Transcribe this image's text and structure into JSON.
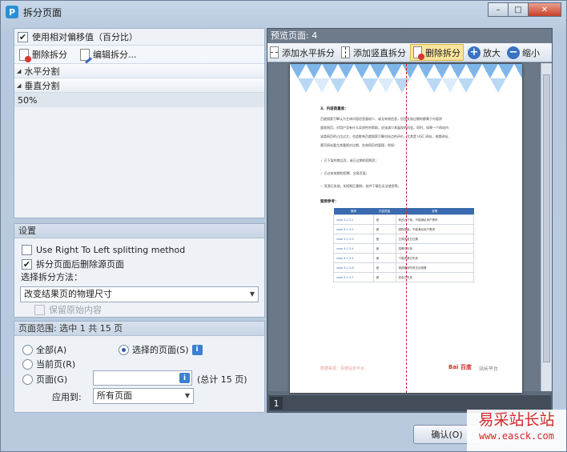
{
  "window": {
    "title": "拆分页面",
    "app_icon_letter": "P",
    "controls": [
      "minimize",
      "maximize",
      "close"
    ]
  },
  "split_panel": {
    "use_relative_offset_label": "使用相对偏移值（百分比）",
    "use_relative_offset_checked": true,
    "toolbar": {
      "delete_label": "删除拆分",
      "edit_label": "编辑拆分..."
    },
    "horizontal_group": "水平分割",
    "vertical_group": "垂直分割",
    "items": [
      {
        "value": "50%"
      }
    ]
  },
  "settings": {
    "title": "设置",
    "rtl_label": "Use Right To Left splitting method",
    "rtl_checked": false,
    "delete_source_label": "拆分页面后删除源页面",
    "delete_source_checked": true,
    "method_label": "选择拆分方法：",
    "method_value": "改变结果页的物理尺寸",
    "keep_content_label": "保留原始内容",
    "keep_content_checked": false
  },
  "page_range": {
    "title": "页面范围: 选中 1 共 15 页",
    "all_label": "全部(A)",
    "current_label": "当前页(R)",
    "pages_label": "页面(G)",
    "selected_label": "选择的页面(S)",
    "selected_on": true,
    "pages_value": "",
    "total_label": "(总计 15 页)",
    "apply_to_label": "应用到:",
    "apply_to_value": "所有页面"
  },
  "preview": {
    "label": "预览页面: 4",
    "toolbar": {
      "add_horizontal": "添加水平拆分",
      "add_vertical": "添加竖直拆分",
      "delete": "删除拆分",
      "zoom_in": "放大",
      "zoom_out": "缩小"
    },
    "page_tab": "1",
    "document": {
      "heading": "3、内容质量差：",
      "paragraph_lines": [
        "百度搜索引擎认为主体内容信息量较少，或无有效信息，信息失效过期的都属于内容质",
        "量差网页，对用户没有什么实质性的帮助，应该减少其展现的机会。同时，如果一个网站内",
        "该类网页的占比过大，也会影响百度搜索引擎对站点的评价，尤其是 UGC 网站、电商网站、",
        "黄页网站要尤其重视对过期、失效网页的管理，例如："
      ],
      "bullets": [
        "已下架的商品页，或已过期的团购页；",
        "已过有效期的招聘、交易页面；",
        "资源已失效，如视频已删除、软件下载后无法使用等。"
      ],
      "case_title": "案例参考：",
      "table_headers": [
        "案例",
        "内容质量",
        "说明"
      ],
      "table_rows": [
        [
          "case 3.1.3-1",
          "差",
          "商品已下架，不能满足用户需求"
        ],
        [
          "case 3.1.3-2",
          "差",
          "团购结束，不能满足用户需求"
        ],
        [
          "case 3.1.3-3",
          "差",
          "交易信息已过期"
        ],
        [
          "case 3.1.3-4",
          "差",
          "招聘已失效"
        ],
        [
          "case 3.1.3-5",
          "差",
          "下载资源已失效"
        ],
        [
          "case 3.1.3-6",
          "差",
          "视频播放失败无法观看"
        ],
        [
          "case 3.1.3-7",
          "差",
          "信息已失效"
        ]
      ],
      "footer_source": "数据来源：百度站长平台",
      "footer_logo": "Bai 百度",
      "footer_brand": "站长平台"
    }
  },
  "confirm_button": "确认(O)",
  "watermark": {
    "name": "易采站长站",
    "url": "www.easck.com"
  },
  "colors": {
    "accent_blue": "#3a72c2",
    "active_button": "#fbe59a",
    "split_line": "#cc2222",
    "watermark_red": "#d62828"
  }
}
